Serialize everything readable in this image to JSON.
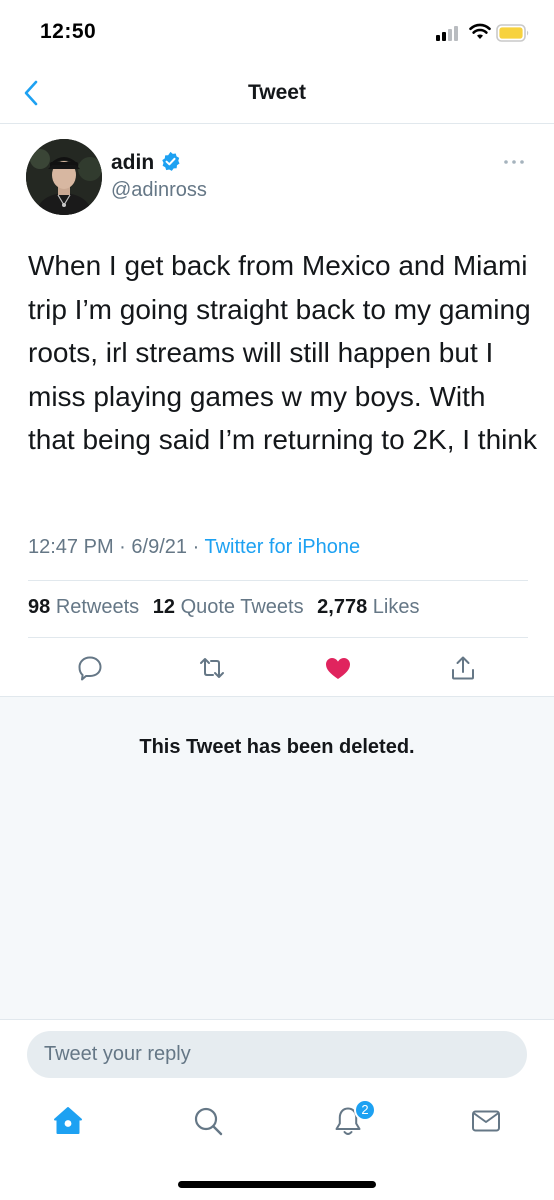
{
  "status_bar": {
    "time": "12:50",
    "signal_icon": "cellular-signal-icon",
    "wifi_icon": "wifi-icon",
    "battery_icon": "battery-low-power-icon",
    "battery_color": "#f7d23e"
  },
  "header": {
    "title": "Tweet",
    "back_icon": "chevron-left-icon"
  },
  "tweet": {
    "author": {
      "name": "adin",
      "handle": "@adinross",
      "verified": true,
      "verified_icon": "verified-badge-icon"
    },
    "text": "When I get back from Mexico and Miami trip I’m going straight back to my gaming roots, irl streams will still happen but I miss playing games w my boys. With that being said I’m returning to 2K, I think",
    "time": "12:47 PM",
    "separator": "·",
    "date": "6/9/21",
    "source": "Twitter for iPhone",
    "stats": {
      "retweets_count": "98",
      "retweets_label": "Retweets",
      "quotes_count": "12",
      "quotes_label": "Quote Tweets",
      "likes_count": "2,778",
      "likes_label": "Likes"
    },
    "actions": [
      "reply-icon",
      "retweet-icon",
      "like-heart-icon",
      "share-icon"
    ],
    "liked": true
  },
  "deleted_notice": "This Tweet has been deleted.",
  "reply": {
    "placeholder": "Tweet your reply"
  },
  "tab_bar": {
    "tabs": [
      "home-icon",
      "search-icon",
      "notifications-bell-icon",
      "messages-envelope-icon"
    ],
    "notifications_badge": "2"
  },
  "colors": {
    "accent": "#1da1f2",
    "like": "#e0245e",
    "secondary_text": "#657786",
    "divider": "#e1e8ed",
    "deleted_bg": "#f5f8fa"
  }
}
